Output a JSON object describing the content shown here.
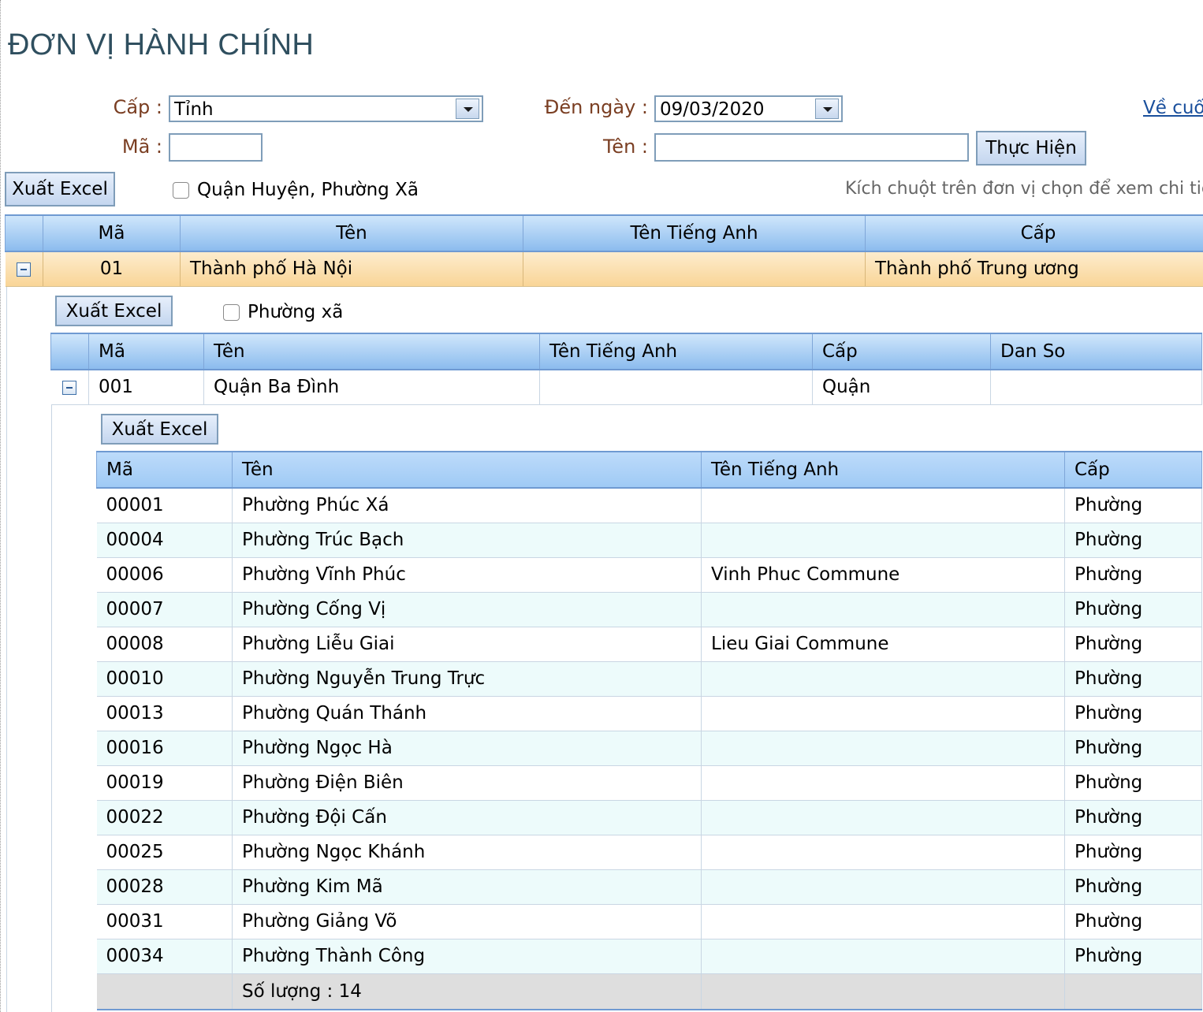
{
  "page": {
    "title": "ĐƠN VỊ HÀNH CHÍNH"
  },
  "filters": {
    "cap_label": "Cấp :",
    "cap_value": "Tỉnh",
    "ma_label": "Mã :",
    "ma_value": "",
    "den_ngay_label": "Đến ngày :",
    "den_ngay_value": "09/03/2020",
    "ten_label": "Tên :",
    "ten_value": "",
    "submit_label": "Thực Hiện",
    "back_link": "Về cuố"
  },
  "toolbar": {
    "export_label": "Xuất Excel",
    "checkbox_label": "Quận Huyện, Phường Xã",
    "hint": "Kích chuột trên đơn vị chọn để xem chi tiết"
  },
  "provinces": {
    "columns": [
      "Mã",
      "Tên",
      "Tên Tiếng Anh",
      "Cấp"
    ],
    "row": {
      "ma": "01",
      "ten": "Thành phố Hà Nội",
      "ten_tieng_anh": "",
      "cap": "Thành phố Trung ương"
    }
  },
  "districts": {
    "export_label": "Xuất Excel",
    "checkbox_label": "Phường xã",
    "columns": [
      "Mã",
      "Tên",
      "Tên Tiếng Anh",
      "Cấp",
      "Dan So"
    ],
    "row": {
      "ma": "001",
      "ten": "Quận Ba Đình",
      "ten_tieng_anh": "",
      "cap": "Quận",
      "dan_so": ""
    }
  },
  "wards": {
    "export_label": "Xuất Excel",
    "columns": [
      "Mã",
      "Tên",
      "Tên Tiếng Anh",
      "Cấp"
    ],
    "rows": [
      {
        "ma": "00001",
        "ten": "Phường Phúc Xá",
        "ten_tieng_anh": "",
        "cap": "Phường"
      },
      {
        "ma": "00004",
        "ten": "Phường Trúc Bạch",
        "ten_tieng_anh": "",
        "cap": "Phường"
      },
      {
        "ma": "00006",
        "ten": "Phường Vĩnh Phúc",
        "ten_tieng_anh": "Vinh Phuc Commune",
        "cap": "Phường"
      },
      {
        "ma": "00007",
        "ten": "Phường Cống Vị",
        "ten_tieng_anh": "",
        "cap": "Phường"
      },
      {
        "ma": "00008",
        "ten": "Phường Liễu Giai",
        "ten_tieng_anh": "Lieu Giai Commune",
        "cap": "Phường"
      },
      {
        "ma": "00010",
        "ten": "Phường Nguyễn Trung Trực",
        "ten_tieng_anh": "",
        "cap": "Phường"
      },
      {
        "ma": "00013",
        "ten": "Phường Quán Thánh",
        "ten_tieng_anh": "",
        "cap": "Phường"
      },
      {
        "ma": "00016",
        "ten": "Phường Ngọc Hà",
        "ten_tieng_anh": "",
        "cap": "Phường"
      },
      {
        "ma": "00019",
        "ten": "Phường Điện Biên",
        "ten_tieng_anh": "",
        "cap": "Phường"
      },
      {
        "ma": "00022",
        "ten": "Phường Đội Cấn",
        "ten_tieng_anh": "",
        "cap": "Phường"
      },
      {
        "ma": "00025",
        "ten": "Phường Ngọc Khánh",
        "ten_tieng_anh": "",
        "cap": "Phường"
      },
      {
        "ma": "00028",
        "ten": "Phường Kim Mã",
        "ten_tieng_anh": "",
        "cap": "Phường"
      },
      {
        "ma": "00031",
        "ten": "Phường Giảng Võ",
        "ten_tieng_anh": "",
        "cap": "Phường"
      },
      {
        "ma": "00034",
        "ten": "Phường Thành Công",
        "ten_tieng_anh": "",
        "cap": "Phường"
      }
    ],
    "footer": "Số lượng : 14"
  }
}
